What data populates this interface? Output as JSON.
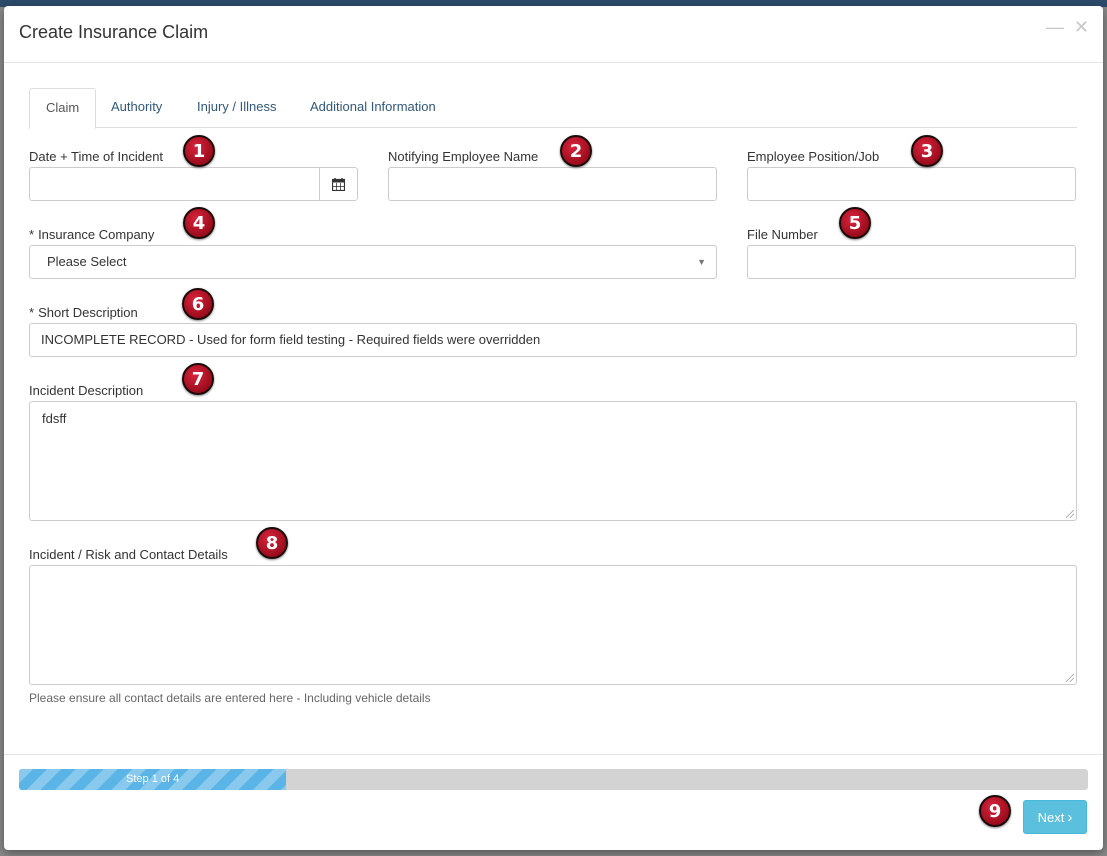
{
  "modal": {
    "title": "Create Insurance Claim",
    "minimize_glyph": "—",
    "close_glyph": "✕"
  },
  "tabs": [
    {
      "label": "Claim",
      "active": true
    },
    {
      "label": "Authority",
      "active": false
    },
    {
      "label": "Injury / Illness",
      "active": false
    },
    {
      "label": "Additional Information",
      "active": false
    }
  ],
  "fields": {
    "incident_datetime": {
      "label": "Date + Time of Incident",
      "value": "",
      "icon": "calendar-icon"
    },
    "notifying_employee": {
      "label": "Notifying Employee Name",
      "value": ""
    },
    "employee_position": {
      "label": "Employee Position/Job",
      "value": ""
    },
    "insurance_company": {
      "label": "Insurance Company",
      "required_marker": "*",
      "value": "Please Select"
    },
    "file_number": {
      "label": "File Number",
      "value": ""
    },
    "short_description": {
      "label": "Short Description",
      "required_marker": "*",
      "value": "INCOMPLETE RECORD - Used for form field testing - Required fields were overridden"
    },
    "incident_description": {
      "label": "Incident Description",
      "value": "fdsff"
    },
    "risk_contact_details": {
      "label": "Incident / Risk and Contact Details",
      "value": "",
      "help": "Please ensure all contact details are entered here - Including vehicle details"
    }
  },
  "progress": {
    "label": "Step 1 of 4",
    "fraction": 0.25,
    "color": "#5bb4e6"
  },
  "next_button": {
    "label": "Next",
    "chevron": "›"
  },
  "annotations": [
    "1",
    "2",
    "3",
    "4",
    "5",
    "6",
    "7",
    "8",
    "9"
  ]
}
